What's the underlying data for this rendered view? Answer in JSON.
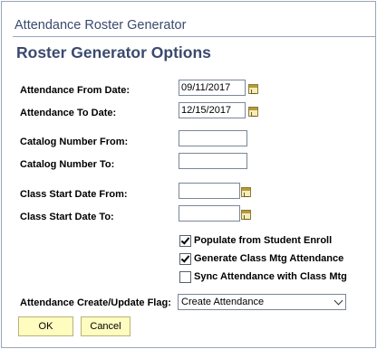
{
  "app_title": "Attendance Roster Generator",
  "page_title": "Roster Generator Options",
  "fields": {
    "from_date_label": "Attendance From Date:",
    "from_date_value": "09/11/2017",
    "to_date_label": "Attendance To Date:",
    "to_date_value": "12/15/2017",
    "catalog_from_label": "Catalog Number From:",
    "catalog_from_value": "",
    "catalog_to_label": "Catalog Number To:",
    "catalog_to_value": "",
    "class_start_from_label": "Class Start Date From:",
    "class_start_from_value": "",
    "class_start_to_label": "Class Start Date To:",
    "class_start_to_value": ""
  },
  "checkboxes": [
    {
      "label": "Populate from Student Enroll",
      "checked": true
    },
    {
      "label": "Generate Class Mtg Attendance",
      "checked": true
    },
    {
      "label": "Sync Attendance with Class Mtg",
      "checked": false
    }
  ],
  "flag": {
    "label": "Attendance Create/Update Flag:",
    "selected": "Create Attendance"
  },
  "buttons": {
    "ok": "OK",
    "cancel": "Cancel"
  },
  "icons": {
    "calendar": "calendar-icon",
    "dropdown": "chevron-down-icon"
  }
}
